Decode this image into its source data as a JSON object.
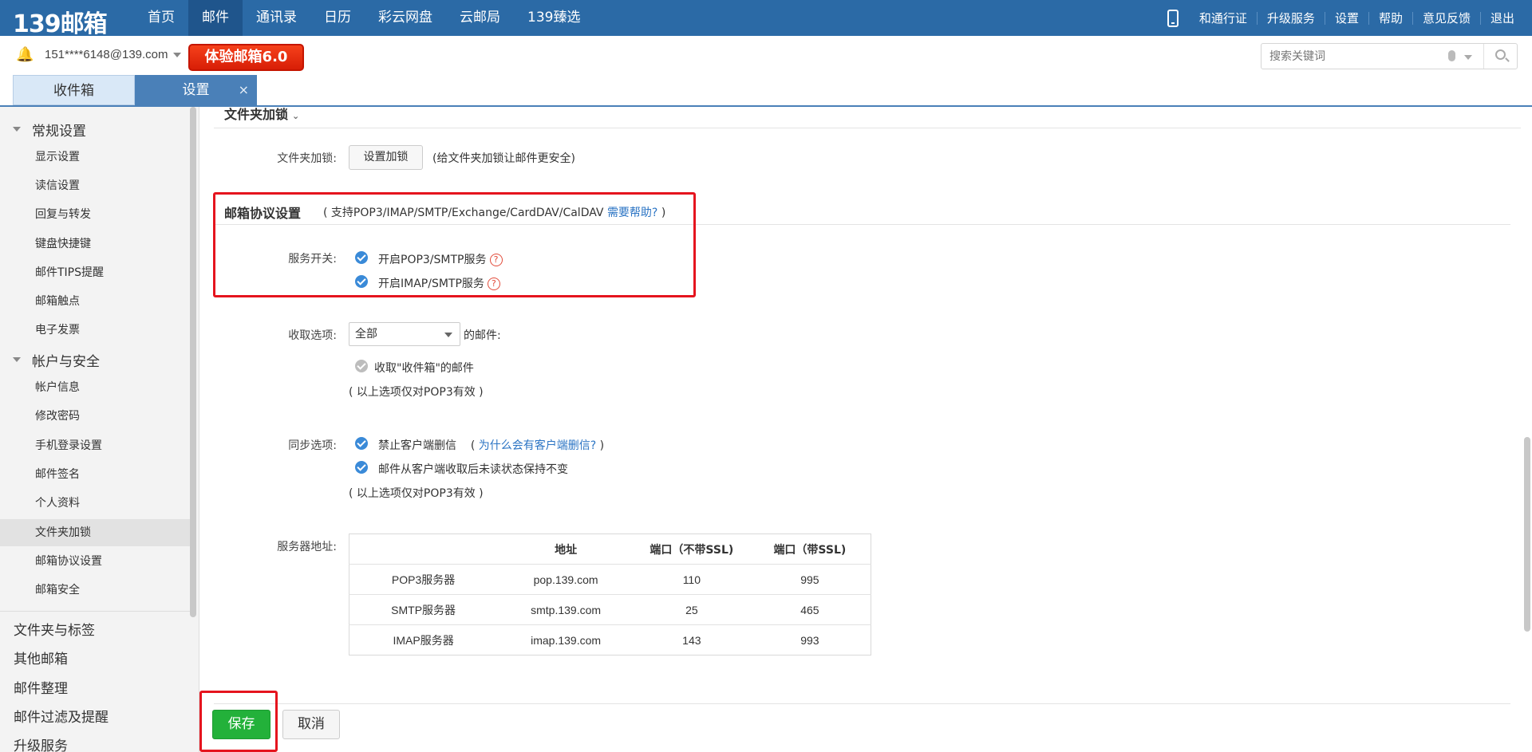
{
  "topbar": {
    "logo": "139邮箱",
    "nav": [
      "首页",
      "邮件",
      "通讯录",
      "日历",
      "彩云网盘",
      "云邮局",
      "139臻选"
    ],
    "active_nav": "邮件",
    "right_links": [
      "和通行证",
      "升级服务",
      "设置",
      "帮助",
      "意见反馈",
      "退出"
    ]
  },
  "account": {
    "email": "151****6148@139.com",
    "experience_button": "体验邮箱6.0"
  },
  "search": {
    "placeholder": "搜索关键词"
  },
  "tabs": [
    {
      "label": "收件箱"
    },
    {
      "label": "设置",
      "close": "×"
    }
  ],
  "sidebar": {
    "group1": "常规设置",
    "group1_items": [
      "显示设置",
      "读信设置",
      "回复与转发",
      "键盘快捷键",
      "邮件TIPS提醒",
      "邮箱触点",
      "电子发票"
    ],
    "group2": "帐户与安全",
    "group2_items": [
      "帐户信息",
      "修改密码",
      "手机登录设置",
      "邮件签名",
      "个人资料",
      "文件夹加锁",
      "邮箱协议设置",
      "邮箱安全"
    ],
    "active_item": "文件夹加锁",
    "top_items": [
      "文件夹与标签",
      "其他邮箱",
      "邮件整理",
      "邮件过滤及提醒",
      "升级服务"
    ]
  },
  "folder_lock": {
    "section_title": "文件夹加锁",
    "label": "文件夹加锁:",
    "button": "设置加锁",
    "hint": "(给文件夹加锁让邮件更安全)"
  },
  "protocol": {
    "section_title": "邮箱协议设置",
    "support_text": "( 支持POP3/IMAP/SMTP/Exchange/CardDAV/CalDAV",
    "help_link": "需要帮助?",
    "support_close": ")",
    "service_label": "服务开关:",
    "pop3_option": "开启POP3/SMTP服务",
    "imap_option": "开启IMAP/SMTP服务",
    "help_mark": "?"
  },
  "receive": {
    "label": "收取选项:",
    "select_value": "全部",
    "suffix": "的邮件:",
    "inbox_option": "收取\"收件箱\"的邮件",
    "note": "( 以上选项仅对POP3有效 )"
  },
  "sync": {
    "label": "同步选项:",
    "option1": "禁止客户端删信",
    "why_open": "(",
    "why_link": "为什么会有客户端删信?",
    "why_close": ")",
    "option2": "邮件从客户端收取后未读状态保持不变",
    "note": "( 以上选项仅对POP3有效 )"
  },
  "servers": {
    "label": "服务器地址:",
    "headers": [
      "",
      "地址",
      "端口（不带SSL)",
      "端口（带SSL)"
    ],
    "rows": [
      [
        "POP3服务器",
        "pop.139.com",
        "110",
        "995"
      ],
      [
        "SMTP服务器",
        "smtp.139.com",
        "25",
        "465"
      ],
      [
        "IMAP服务器",
        "imap.139.com",
        "143",
        "993"
      ]
    ]
  },
  "actions": {
    "save": "保存",
    "cancel": "取消"
  },
  "colors": {
    "topbar": "#2b6aa6",
    "save": "#23b13a",
    "highlight": "#e5141e",
    "check": "#3a8ad8"
  }
}
